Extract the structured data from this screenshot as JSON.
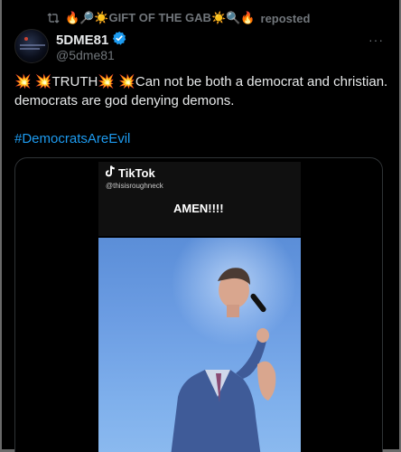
{
  "repost": {
    "reposter_name": "🔥🔎☀️GIFT OF THE GAB☀️🔍🔥",
    "label": "reposted"
  },
  "author": {
    "display_name": "5DME81",
    "handle": "@5dme81"
  },
  "post": {
    "text": "💥 💥TRUTH💥 💥Can not be both a democrat and christian. democrats are god denying demons.",
    "hashtag": "#DemocratsAreEvil"
  },
  "media": {
    "tiktok_brand": "TikTok",
    "tiktok_handle": "@thisisroughneck",
    "caption": "AMEN!!!!"
  },
  "more_label": "···",
  "colors": {
    "background": "#000000",
    "text": "#e7e9ea",
    "muted": "#71767b",
    "link": "#1d9bf0",
    "verified": "#1d9bf0"
  },
  "icons": {
    "repost": "repost-icon",
    "verified": "verified-badge-icon",
    "tiktok": "tiktok-logo-icon",
    "more": "more-options-icon"
  }
}
